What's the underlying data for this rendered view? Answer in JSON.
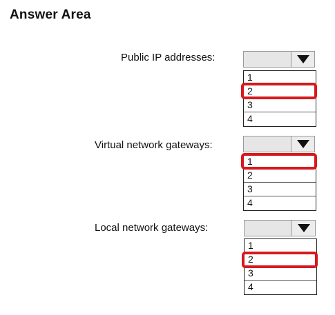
{
  "title": "Answer Area",
  "questions": [
    {
      "label": "Public IP addresses:",
      "options": [
        "1",
        "2",
        "3",
        "4"
      ],
      "selected": "2"
    },
    {
      "label": "Virtual network gateways:",
      "options": [
        "1",
        "2",
        "3",
        "4"
      ],
      "selected": "1"
    },
    {
      "label": "Local network gateways:",
      "options": [
        "1",
        "2",
        "3",
        "4"
      ],
      "selected": "2"
    }
  ],
  "colors": {
    "highlight": "#d7191c",
    "dropdown_bg": "#e6e6e6"
  },
  "icons": {
    "dropdown_arrow": "chevron-down-icon"
  }
}
